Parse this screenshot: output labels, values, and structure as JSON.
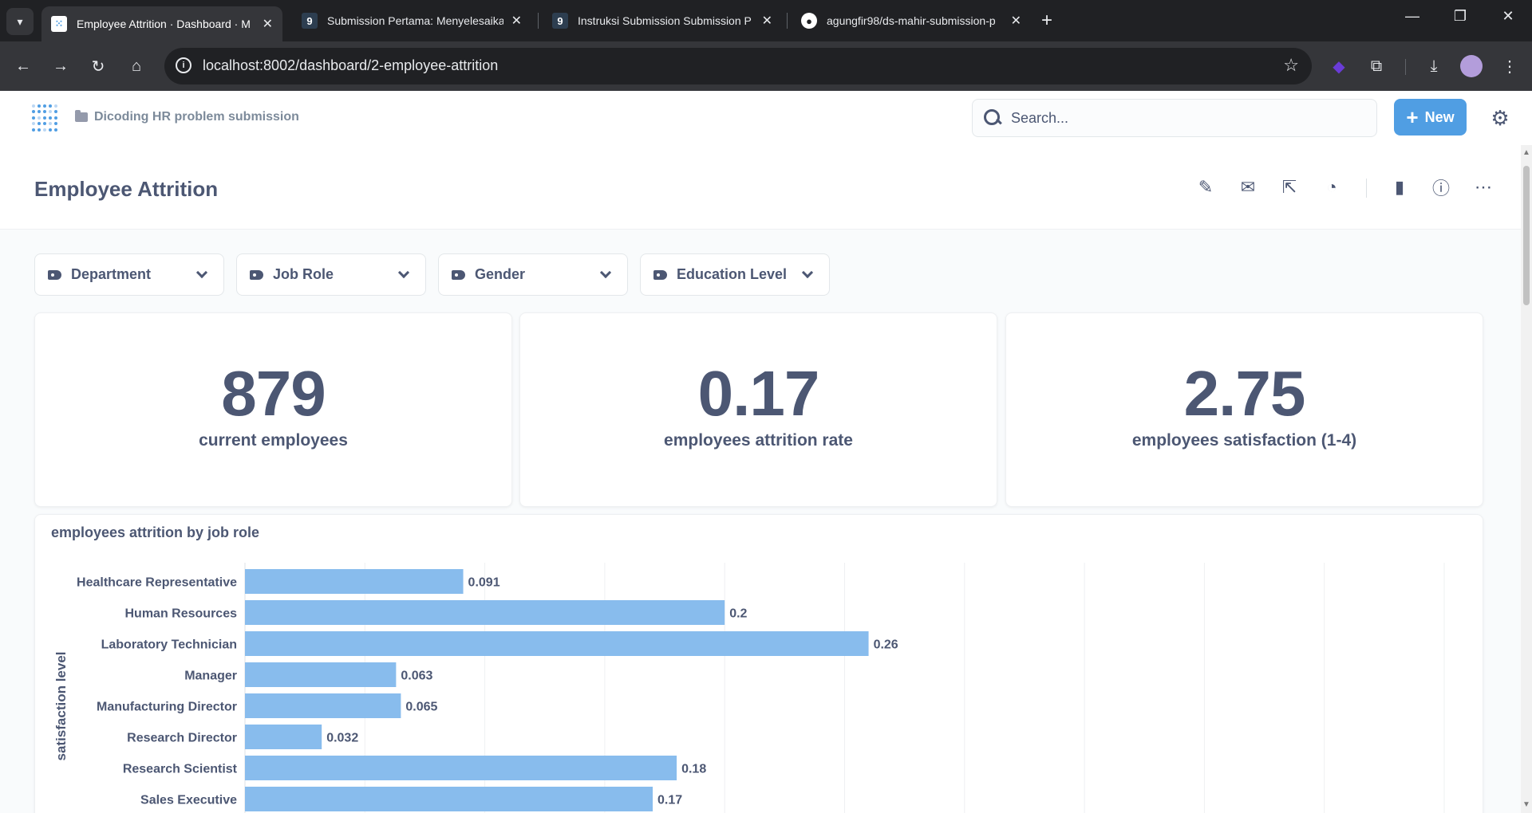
{
  "browser": {
    "tabs": [
      {
        "title": "Employee Attrition · Dashboard · M",
        "active": true,
        "icon": "metabase-icon"
      },
      {
        "title": "Submission Pertama: Menyelesaika",
        "active": false,
        "icon": "dicoding-icon"
      },
      {
        "title": "Instruksi Submission Submission P",
        "active": false,
        "icon": "dicoding-icon"
      },
      {
        "title": "agungfir98/ds-mahir-submission-p",
        "active": false,
        "icon": "github-icon"
      }
    ],
    "url": "localhost:8002/dashboard/2-employee-attrition"
  },
  "app": {
    "breadcrumb": "Dicoding HR problem submission",
    "search_placeholder": "Search...",
    "new_label": "New"
  },
  "dashboard": {
    "title": "Employee Attrition",
    "filters": [
      "Department",
      "Job Role",
      "Gender",
      "Education Level"
    ],
    "scalars": [
      {
        "value": "879",
        "caption": "current employees"
      },
      {
        "value": "0.17",
        "caption": "employees attrition rate"
      },
      {
        "value": "2.75",
        "caption": "employees satisfaction (1-4)"
      }
    ]
  },
  "colors": {
    "accent": "#509ee3",
    "bar": "#88bced",
    "text": "#4c5773"
  },
  "chart_data": {
    "type": "bar",
    "orientation": "horizontal",
    "title": "employees attrition by job role",
    "ylabel": "satisfaction level",
    "categories": [
      "Healthcare Representative",
      "Human Resources",
      "Laboratory Technician",
      "Manager",
      "Manufacturing Director",
      "Research Director",
      "Research Scientist",
      "Sales Executive"
    ],
    "values": [
      0.091,
      0.2,
      0.26,
      0.063,
      0.065,
      0.032,
      0.18,
      0.17
    ],
    "value_labels": [
      "0.091",
      "0.2",
      "0.26",
      "0.063",
      "0.065",
      "0.032",
      "0.18",
      "0.17"
    ],
    "xlim": [
      0,
      0.5
    ],
    "grid": true
  }
}
